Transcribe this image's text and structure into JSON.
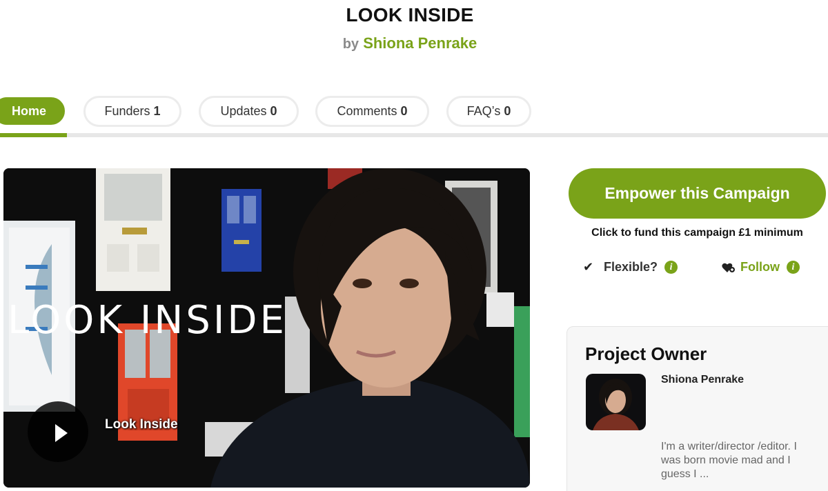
{
  "header": {
    "title": "LOOK INSIDE",
    "by_label": "by",
    "author": "Shiona Penrake"
  },
  "tabs": [
    {
      "label": "Home",
      "count": null,
      "active": true
    },
    {
      "label": "Funders",
      "count": "1",
      "active": false
    },
    {
      "label": "Updates",
      "count": "0",
      "active": false
    },
    {
      "label": "Comments",
      "count": "0",
      "active": false
    },
    {
      "label": "FAQ’s",
      "count": "0",
      "active": false
    }
  ],
  "video": {
    "overlay_title": "LOOK INSIDE",
    "caption": "Look Inside",
    "play_icon": "play-icon"
  },
  "sidebar": {
    "cta_label": "Empower this Campaign",
    "cta_note": "Click to fund this campaign £1 minimum",
    "flexible_label": "Flexible?",
    "follow_label": "Follow",
    "info_glyph": "i"
  },
  "owner": {
    "heading": "Project Owner",
    "name": "Shiona Penrake",
    "bio": "I'm a writer/director /editor. I was born movie mad and I guess I ..."
  },
  "colors": {
    "accent": "#7aa319",
    "tab_border": "#ececec",
    "card_bg": "#f7f7f7"
  }
}
